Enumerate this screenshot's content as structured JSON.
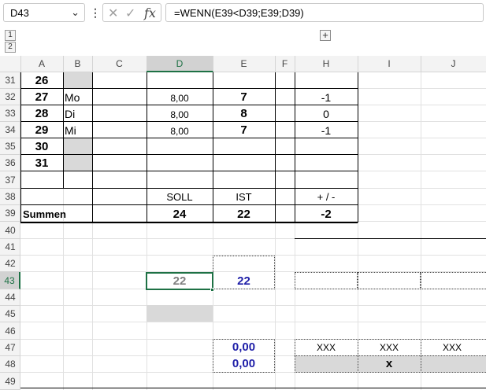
{
  "name_box": "D43",
  "formula": "=WENN(E39<D39;E39;D39)",
  "fx_label": "fx",
  "outline_levels": [
    "1",
    "2"
  ],
  "columns": [
    "A",
    "B",
    "C",
    "D",
    "E",
    "F",
    "H",
    "I",
    "J"
  ],
  "rows": [
    "31",
    "32",
    "33",
    "34",
    "35",
    "36",
    "37",
    "38",
    "39",
    "40",
    "41",
    "42",
    "43",
    "44",
    "45",
    "46",
    "47",
    "48",
    "49"
  ],
  "cells": {
    "a31": "26",
    "a32": "27",
    "a33": "28",
    "a34": "29",
    "a35": "30",
    "a36": "31",
    "b32": "Mo",
    "b33": "Di",
    "b34": "Mi",
    "d32": "8,00",
    "d33": "8,00",
    "d34": "8,00",
    "e32": "7",
    "e33": "8",
    "e34": "7",
    "h32": "-1",
    "h33": "0",
    "h34": "-1",
    "d38": "SOLL",
    "e38": "IST",
    "h38": "+ / -",
    "a39": "Summen",
    "d39": "24",
    "e39": "22",
    "h39": "-2",
    "d43": "22",
    "e43": "22",
    "e47": "0,00",
    "e48": "0,00",
    "h47": "XXX",
    "i47": "XXX",
    "j47": "XXX",
    "i48": "x"
  },
  "colors": {
    "selection": "#1e7145",
    "blue_value": "#1f1fa8",
    "gray_value": "#808080",
    "fill_gray": "#d9d9d9"
  }
}
